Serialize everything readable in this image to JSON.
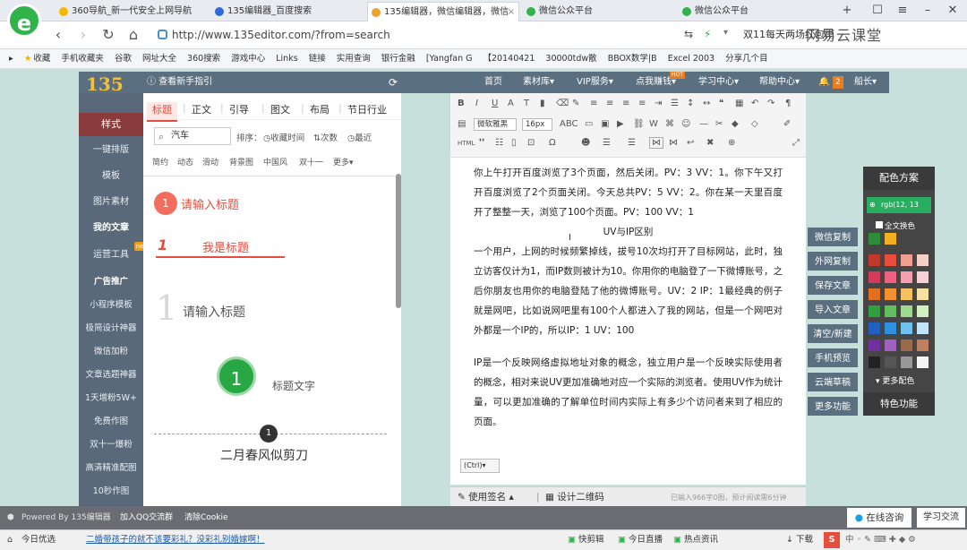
{
  "browser": {
    "tabs": [
      {
        "label": "360导航_新一代安全上网导航",
        "color": "#f5b800"
      },
      {
        "label": "135编辑器_百度搜索",
        "color": "#2b6cd9"
      },
      {
        "label": "135编辑器，微信编辑器，微信",
        "color": "#f0a030"
      },
      {
        "label": "微信公众平台",
        "color": "#2fb34a"
      },
      {
        "label": "微信公众平台",
        "color": "#2fb34a"
      }
    ],
    "logo": "e",
    "url": "http://www.135editor.com/?from=search",
    "promo": "双11每天两场红包雨",
    "watermark": "网易云课堂",
    "bookmarks": [
      "收藏",
      "手机收藏夹",
      "谷歌",
      "网址大全",
      "360搜索",
      "游戏中心",
      "Links",
      "链接",
      "实用查询",
      "银行金融",
      "[Yangfan G",
      "【20140421",
      "30000tdw散",
      "BBOX数学|B",
      "Excel 2003",
      "分享几个目"
    ]
  },
  "editor": {
    "brand": "135",
    "guide": "查看新手指引",
    "nav": [
      "首页",
      "素材库▾",
      "VIP服务▾",
      "点我赚钱▾",
      "学习中心▾",
      "帮助中心▾"
    ],
    "hot": "HOT",
    "notify_count": "2",
    "user": "船长▾",
    "sidebar": [
      {
        "label": "样式",
        "style": "active"
      },
      {
        "label": "一键排版",
        "style": ""
      },
      {
        "label": "模板",
        "style": ""
      },
      {
        "label": "图片素材",
        "style": ""
      },
      {
        "label": "我的文章",
        "style": "bold"
      },
      {
        "label": "运营工具",
        "style": "new"
      },
      {
        "label": "广告推广",
        "style": "bold"
      },
      {
        "label": "小程序模板",
        "style": ""
      },
      {
        "label": "极简设计神器",
        "style": ""
      },
      {
        "label": "微信加粉",
        "style": ""
      },
      {
        "label": "文章选题神器",
        "style": ""
      },
      {
        "label": "1天增粉5W+",
        "style": ""
      },
      {
        "label": "免费作图",
        "style": ""
      },
      {
        "label": "双十一爆粉",
        "style": ""
      },
      {
        "label": "高清精准配图",
        "style": ""
      },
      {
        "label": "10秒作图",
        "style": ""
      }
    ],
    "new_badge": "new",
    "panel": {
      "tabs": [
        "标题",
        "正文",
        "引导",
        "图文",
        "布局",
        "节日行业"
      ],
      "search_value": "汽车",
      "sort_label": "排序：",
      "sort_opts": [
        "收藏时间",
        "次数",
        "最近"
      ],
      "tags": [
        "简约",
        "动态",
        "滑动",
        "背景图",
        "中国风",
        "双十一",
        "更多▾"
      ],
      "samples": [
        {
          "num": "1",
          "text": "请输入标题"
        },
        {
          "num": "1",
          "text": "我是标题"
        },
        {
          "num": "1",
          "text": "请输入标题"
        },
        {
          "num": "1",
          "text": "标题文字"
        },
        {
          "num": "1",
          "text": "二月春风似剪刀"
        }
      ]
    },
    "toolbar": {
      "font": "微软雅黑",
      "size": "16px"
    },
    "body_paras": [
      {
        "text": "你上午打开百度浏览了3个页面，然后关闭。PV：3   VV：1。你下午又打开百度浏览了2个页面关闭。今天总共PV：5  VV：2。你在某一天里百度开了整整一天，浏览了100个页面。PV：100  VV：1",
        "cls": ""
      },
      {
        "text": "UV与IP区别",
        "cls": "center"
      },
      {
        "text": "一个用户，上网的时候频繁掉线，拔号10次均打开了目标网站，此时，独立访客仅计为1，而IP数则被计为10。你用你的电脑登了一下微博账号，之后你朋友也用你的电脑登陆了他的微博账号。UV：2  IP：1最经典的例子就是网吧，比如说网吧里有100个人都进入了我的网站，但是一个网吧对外都是一个IP的，所以IP：1  UV：100",
        "cls": ""
      },
      {
        "text": "IP是一个反映网络虚拟地址对象的概念，独立用户是一个反映实际使用者的概念，相对来说UV更加准确地对应一个实际的浏览者。使用UV作为统计量，可以更加准确的了解单位时间内实际上有多少个访问者来到了相应的页面。",
        "cls": "gap"
      }
    ],
    "mini_tag": "(Ctrl)▾",
    "footer": {
      "sign": "使用签名 ▴",
      "qr": "设计二维码",
      "stats": "已输入966字0图，预计阅读需6分钟"
    },
    "actions": [
      "微信复制",
      "外网复制",
      "保存文章",
      "导入文章",
      "清空/新建",
      "手机预览",
      "云端草稿",
      "更多功能"
    ],
    "color_panel": {
      "title": "配色方案",
      "rgb": "rgb(12, 13",
      "toggle": "全文换色",
      "more": "更多配色",
      "special": "特色功能",
      "swatches": [
        "#2e8b3a",
        "#f0b020",
        "#c0392b",
        "#e74c3c",
        "#f0a090",
        "#f5d0c8",
        "#d63a5a",
        "#f06080",
        "#f4a0b0",
        "#f8d0d8",
        "#e07020",
        "#f59030",
        "#f5c060",
        "#f8e0a0",
        "#2e9e3e",
        "#60c060",
        "#a0d890",
        "#d0f0c0",
        "#2060c0",
        "#3090e0",
        "#70c0f0",
        "#c0e4f8",
        "#7030a0",
        "#a060c0",
        "#9a6a4a",
        "#c08060",
        "#222222",
        "#555555",
        "#999999",
        "#f5f5f5"
      ]
    }
  },
  "bottom": {
    "powered": "Powered By 135编辑器",
    "qq": "加入QQ交流群",
    "cookie": "清除Cookie",
    "consult": "在线咨询",
    "learn": "学习交流",
    "news": "今日优选",
    "headline": "二婚带孩子的就不该要彩礼？没彩礼别婚嫁啊！",
    "tray": [
      "快剪辑",
      "今日直播",
      "热点资讯",
      "下载"
    ]
  }
}
